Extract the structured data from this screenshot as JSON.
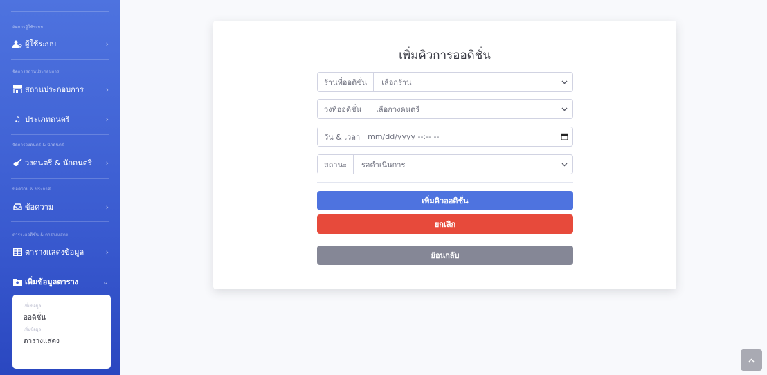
{
  "sidebar": {
    "sections": [
      {
        "heading": "จัดการผู้ใช้ระบบ"
      },
      {
        "heading": "จัดการสถานประกอบการ"
      },
      {
        "heading": "จัดการวงดนตรี & นักดนตรี"
      },
      {
        "heading": "ข้อความ & ประกาศ"
      },
      {
        "heading": "ตารางออดิชั่น & ตารางแสดง"
      }
    ],
    "items": [
      {
        "label": "ผู้ใช้ระบบ",
        "icon": "users-cog-icon"
      },
      {
        "label": "สถานประกอบการ",
        "icon": "store-icon"
      },
      {
        "label": "ประเภทดนตรี",
        "icon": "music-icon"
      },
      {
        "label": "วงดนตรี & นักดนตรี",
        "icon": "guitar-icon"
      },
      {
        "label": "ข้อความ",
        "icon": "inbox-icon"
      },
      {
        "label": "ตารางแสดงข้อมูล",
        "icon": "table-icon"
      },
      {
        "label": "เพิ่มข้อมูลตาราง",
        "icon": "folder-plus-icon"
      }
    ],
    "submenu": {
      "heading1": "เพิ่มข้อมูล",
      "link1": "ออดิชั่น",
      "heading2": "เพิ่มข้อมูล",
      "link2": "ตารางแสดง"
    }
  },
  "form": {
    "title": "เพิ่มคิวการออดิชั่น",
    "shop": {
      "label": "ร้านที่ออดิชั่น",
      "value": "เลือกร้าน"
    },
    "band": {
      "label": "วงที่ออดิชั่น",
      "value": "เลือกวงดนตรี"
    },
    "datetime": {
      "label": "วัน & เวลา",
      "placeholder": "mm/dd/yyyy --:-- --"
    },
    "status": {
      "label": "สถานะ",
      "value": "รอดำเนินการ"
    },
    "submit_label": "เพิ่มคิวออดิชั่น",
    "cancel_label": "ยกเลิก",
    "back_label": "ย้อนกลับ"
  },
  "colors": {
    "sidebar": "#4e73df",
    "primary": "#4e73df",
    "danger": "#e74a3b",
    "secondary": "#858796"
  }
}
